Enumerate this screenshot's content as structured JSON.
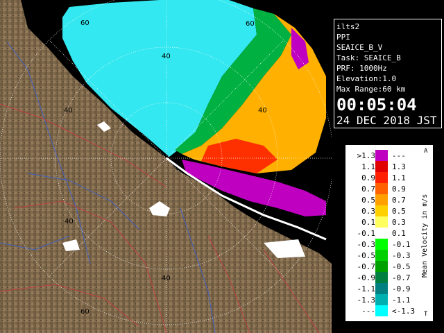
{
  "info": {
    "site": "ilts2",
    "product": "PPI",
    "task_name": "SEAICE_B_V",
    "task": "Task: SEAICE_B",
    "prf": "PRF: 1000Hz",
    "elevation": "Elevation:1.0",
    "max_range": "Max Range:60 km",
    "time": "00:05:04",
    "date": "24 DEC 2018 JST"
  },
  "range_labels": {
    "top_60": "60",
    "top_40": "40",
    "rt_60": "60",
    "rt_40": "40",
    "left_40": "40",
    "lower_40": "40",
    "lower_60": "60",
    "bottom_40": "40"
  },
  "legend": {
    "title": "Mean Velocity in m/s",
    "top_marker": "A",
    "bottom_marker": "T",
    "rows": [
      {
        "lo": ">1.3",
        "hi": "---",
        "color": "#c000c0"
      },
      {
        "lo": "1.1",
        "hi": "1.3",
        "color": "#e00000"
      },
      {
        "lo": "0.9",
        "hi": "1.1",
        "color": "#ff2000"
      },
      {
        "lo": "0.7",
        "hi": "0.9",
        "color": "#ff6000"
      },
      {
        "lo": "0.5",
        "hi": "0.7",
        "color": "#ffa000"
      },
      {
        "lo": "0.3",
        "hi": "0.5",
        "color": "#ffd000"
      },
      {
        "lo": "0.1",
        "hi": "0.3",
        "color": "#ffff60"
      },
      {
        "lo": "-0.1",
        "hi": "0.1",
        "color": "#ffffff"
      },
      {
        "lo": "-0.3",
        "hi": "-0.1",
        "color": "#00ff00"
      },
      {
        "lo": "-0.5",
        "hi": "-0.3",
        "color": "#00d000"
      },
      {
        "lo": "-0.7",
        "hi": "-0.5",
        "color": "#00a000"
      },
      {
        "lo": "-0.9",
        "hi": "-0.7",
        "color": "#008040"
      },
      {
        "lo": "-1.1",
        "hi": "-0.9",
        "color": "#008080"
      },
      {
        "lo": "-1.3",
        "hi": "-1.1",
        "color": "#00b0b0"
      },
      {
        "lo": "---",
        "hi": "<-1.3",
        "color": "#00ffff"
      }
    ]
  },
  "colors": {
    "land": "#7a6448",
    "sea_echo": "#33e8f0",
    "roads": "#c04040",
    "rivers": "#4060c0",
    "rings": "#ffffff"
  }
}
